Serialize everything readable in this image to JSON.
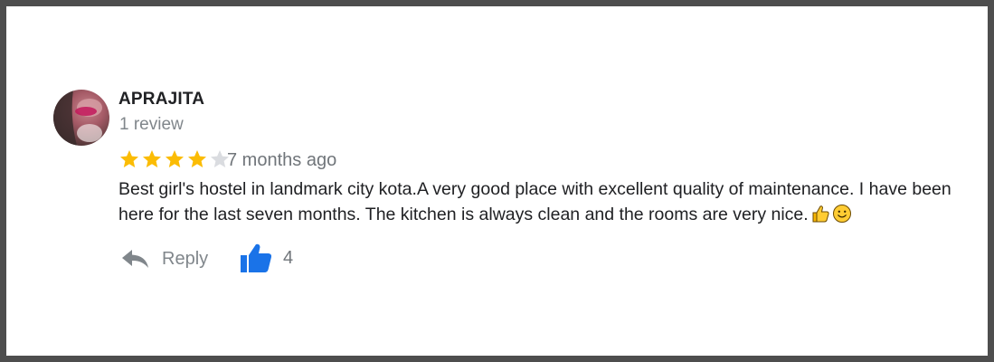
{
  "review": {
    "reviewer_name": "APRAJITA",
    "review_count": "1 review",
    "rating": 4,
    "rating_max": 5,
    "time_ago": "7 months ago",
    "text": "Best girl's hostel in landmark city kota.A very good place with excellent quality of maintenance. I have been here for the last seven months. The kitchen is always clean and the rooms are very nice.",
    "emojis": [
      "thumbs-up-emoji",
      "smiling-face-emoji"
    ]
  },
  "actions": {
    "reply_label": "Reply",
    "like_count": "4"
  },
  "colors": {
    "star_filled": "#fbbc04",
    "star_empty": "#dadce0",
    "like_blue": "#1a73e8",
    "reply_gray": "#80868b"
  }
}
